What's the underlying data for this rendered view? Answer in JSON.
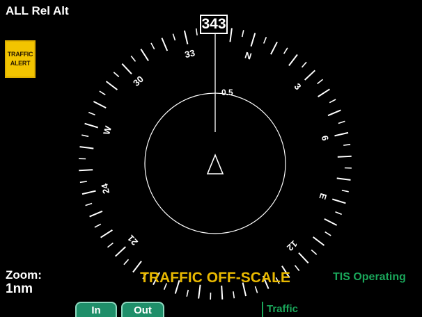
{
  "header": {
    "altitude_mode": "ALL Rel Alt"
  },
  "traffic_alert": {
    "line1": "TRAFFIC",
    "line2": "ALERT"
  },
  "compass": {
    "heading": "343",
    "labels": [
      "33",
      "N",
      "3",
      "6",
      "E",
      "12",
      "21",
      "24",
      "W",
      "30"
    ],
    "range_ring_label": "0.5"
  },
  "zoom": {
    "label": "Zoom:",
    "value": "1nm"
  },
  "status": {
    "offscale": "TRAFFIC OFF-SCALE",
    "tis": "TIS Operating"
  },
  "softkeys": {
    "in": "In",
    "out": "Out",
    "traffic": "Traffic"
  },
  "colors": {
    "alert": "#f2c400",
    "offscale": "#e8b800",
    "tis": "#1aa65a",
    "softkey": "#1f8f6a"
  },
  "icons": {
    "ownship": "ownship-triangle-icon"
  }
}
